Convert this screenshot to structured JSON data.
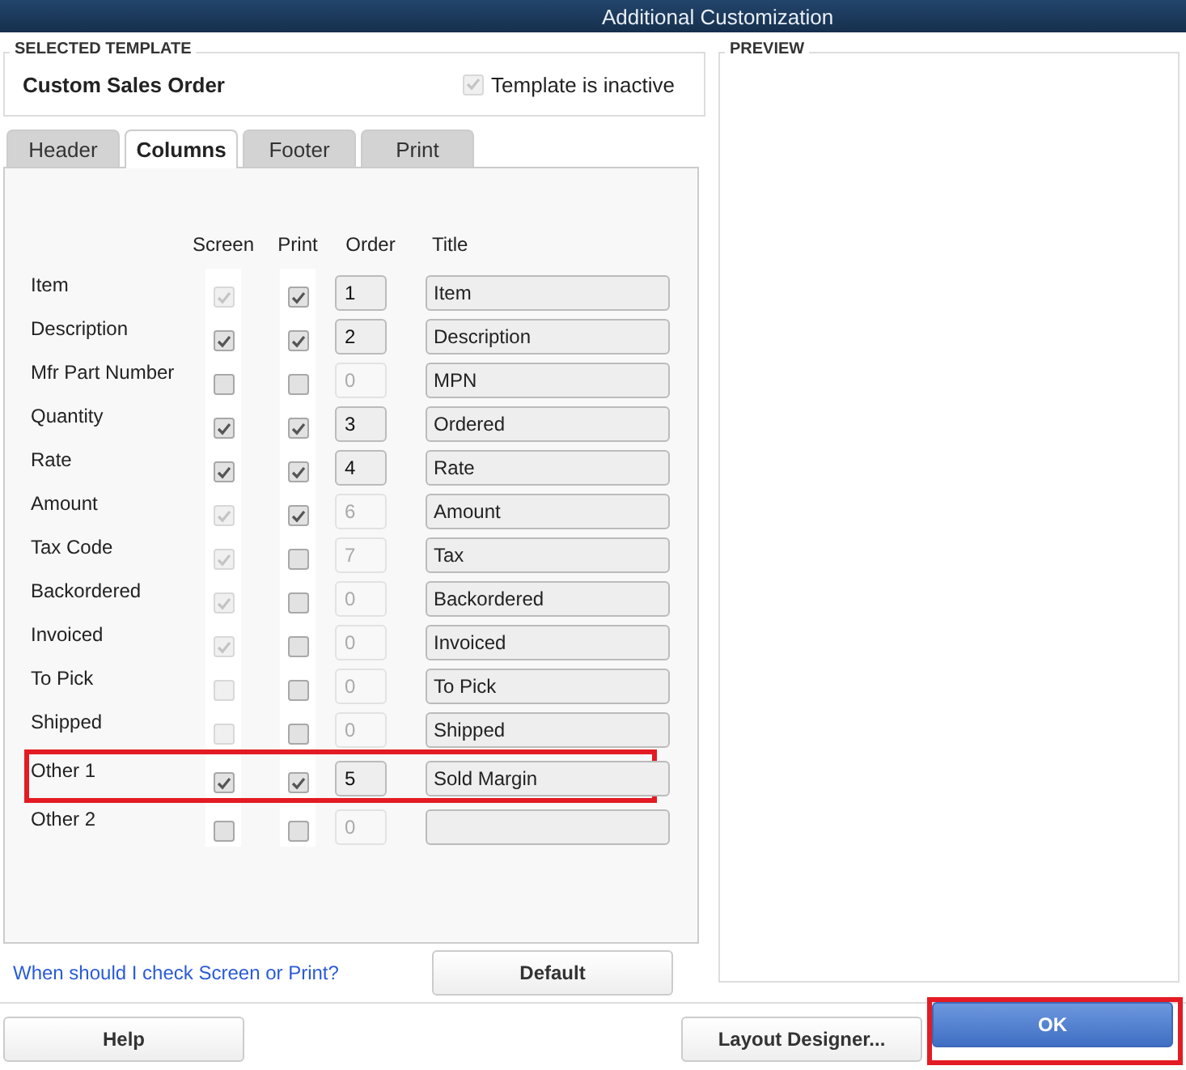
{
  "window": {
    "title": "Additional Customization"
  },
  "selected_template": {
    "legend": "SELECTED TEMPLATE",
    "name": "Custom Sales Order",
    "inactive_checkbox": {
      "label": "Template is inactive",
      "checked": true,
      "disabled": true
    }
  },
  "tabs": [
    {
      "label": "Header",
      "selected": false
    },
    {
      "label": "Columns",
      "selected": true
    },
    {
      "label": "Footer",
      "selected": false
    },
    {
      "label": "Print",
      "selected": false
    }
  ],
  "columns_table": {
    "headers": [
      "Screen",
      "Print",
      "Order",
      "Title"
    ],
    "rows": [
      {
        "name": "Item",
        "screen": {
          "checked": true,
          "disabled": true
        },
        "print": {
          "checked": true,
          "disabled": false
        },
        "order": "1",
        "order_disabled": false,
        "title": "Item",
        "highlighted": false
      },
      {
        "name": "Description",
        "screen": {
          "checked": true,
          "disabled": false
        },
        "print": {
          "checked": true,
          "disabled": false
        },
        "order": "2",
        "order_disabled": false,
        "title": "Description",
        "highlighted": false
      },
      {
        "name": "Mfr Part Number",
        "screen": {
          "checked": false,
          "disabled": false
        },
        "print": {
          "checked": false,
          "disabled": false
        },
        "order": "0",
        "order_disabled": true,
        "title": "MPN",
        "highlighted": false
      },
      {
        "name": "Quantity",
        "screen": {
          "checked": true,
          "disabled": false
        },
        "print": {
          "checked": true,
          "disabled": false
        },
        "order": "3",
        "order_disabled": false,
        "title": "Ordered",
        "highlighted": false
      },
      {
        "name": "Rate",
        "screen": {
          "checked": true,
          "disabled": false
        },
        "print": {
          "checked": true,
          "disabled": false
        },
        "order": "4",
        "order_disabled": false,
        "title": "Rate",
        "highlighted": false
      },
      {
        "name": "Amount",
        "screen": {
          "checked": true,
          "disabled": true
        },
        "print": {
          "checked": true,
          "disabled": false
        },
        "order": "6",
        "order_disabled": true,
        "title": "Amount",
        "highlighted": false
      },
      {
        "name": "Tax Code",
        "screen": {
          "checked": true,
          "disabled": true
        },
        "print": {
          "checked": false,
          "disabled": false
        },
        "order": "7",
        "order_disabled": true,
        "title": "Tax",
        "highlighted": false
      },
      {
        "name": "Backordered",
        "screen": {
          "checked": true,
          "disabled": true
        },
        "print": {
          "checked": false,
          "disabled": false
        },
        "order": "0",
        "order_disabled": true,
        "title": "Backordered",
        "highlighted": false
      },
      {
        "name": "Invoiced",
        "screen": {
          "checked": true,
          "disabled": true
        },
        "print": {
          "checked": false,
          "disabled": false
        },
        "order": "0",
        "order_disabled": true,
        "title": "Invoiced",
        "highlighted": false
      },
      {
        "name": "To Pick",
        "screen": {
          "checked": false,
          "disabled": true
        },
        "print": {
          "checked": false,
          "disabled": false
        },
        "order": "0",
        "order_disabled": true,
        "title": "To Pick",
        "highlighted": false
      },
      {
        "name": "Shipped",
        "screen": {
          "checked": false,
          "disabled": true
        },
        "print": {
          "checked": false,
          "disabled": false
        },
        "order": "0",
        "order_disabled": true,
        "title": "Shipped",
        "highlighted": false
      },
      {
        "name": "Other 1",
        "screen": {
          "checked": true,
          "disabled": false
        },
        "print": {
          "checked": true,
          "disabled": false
        },
        "order": "5",
        "order_disabled": false,
        "title": "Sold Margin",
        "highlighted": true
      },
      {
        "name": "Other 2",
        "screen": {
          "checked": false,
          "disabled": false
        },
        "print": {
          "checked": false,
          "disabled": false
        },
        "order": "0",
        "order_disabled": true,
        "highlighted": false
      }
    ]
  },
  "help_link": "When should I check Screen or Print?",
  "default_button": {
    "label": "Default"
  },
  "preview": {
    "legend": "PREVIEW"
  },
  "buttons": [
    {
      "label": "Help",
      "kind": "plain",
      "highlighted": false
    },
    {
      "label": "Layout Designer...",
      "kind": "plain",
      "highlighted": false
    },
    {
      "label": "OK",
      "kind": "primary",
      "highlighted": true
    }
  ]
}
